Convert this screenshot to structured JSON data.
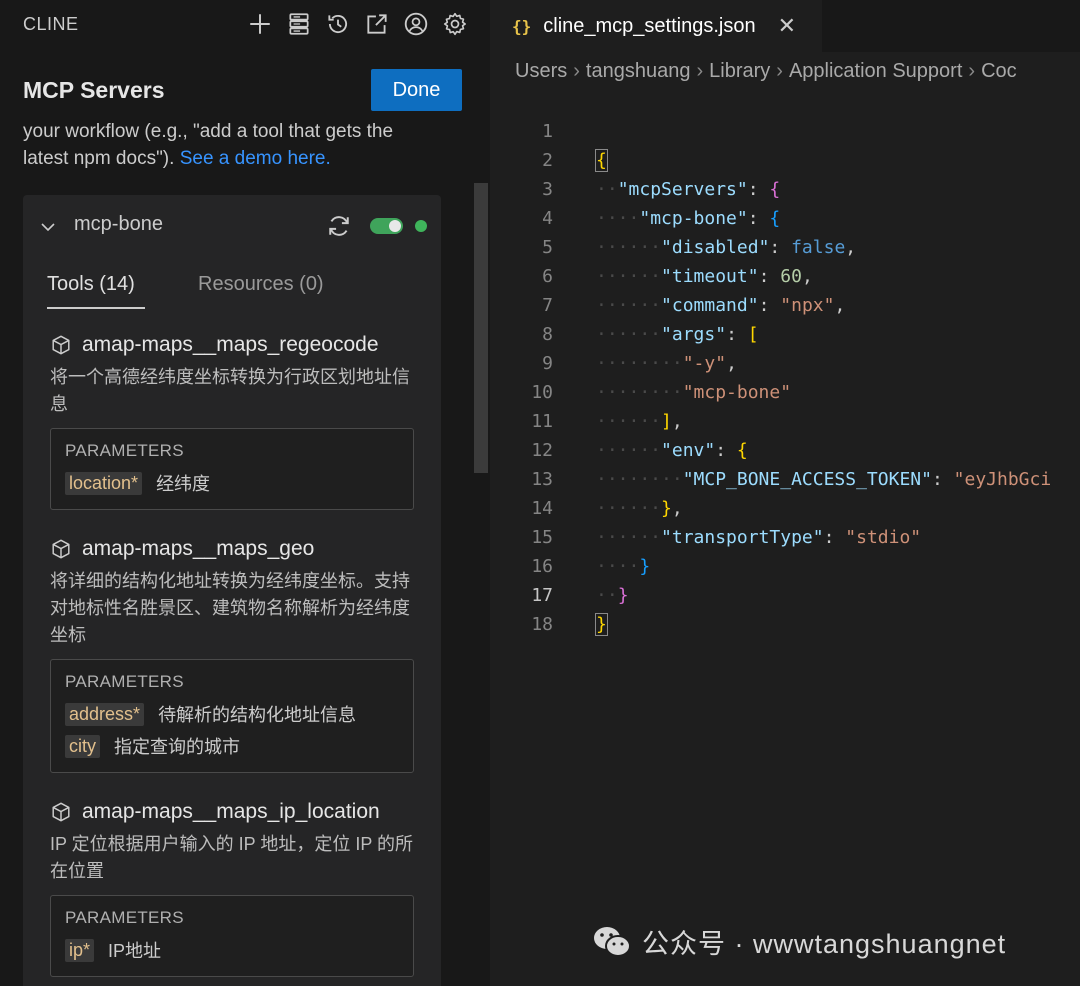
{
  "sidebar": {
    "brand": "CLINE",
    "header_icons": [
      "plus-icon",
      "server-stack-icon",
      "history-icon",
      "external-link-icon",
      "account-icon",
      "gear-icon"
    ],
    "title": "MCP Servers",
    "done_label": "Done",
    "description_text": "your workflow (e.g., \"add a tool that gets the latest npm docs\"). ",
    "description_link": "See a demo here.",
    "server": {
      "name": "mcp-bone",
      "enabled": true,
      "status_color": "#3fb45b",
      "tabs": {
        "tools": "Tools (14)",
        "resources": "Resources (0)"
      },
      "params_label": "PARAMETERS",
      "tools": [
        {
          "name": "amap-maps__maps_regeocode",
          "description": "将一个高德经纬度坐标转换为行政区划地址信息",
          "params": [
            {
              "name": "location",
              "required": "*",
              "desc": "经纬度"
            }
          ]
        },
        {
          "name": "amap-maps__maps_geo",
          "description": "将详细的结构化地址转换为经纬度坐标。支持对地标性名胜景区、建筑物名称解析为经纬度坐标",
          "params": [
            {
              "name": "address",
              "required": "*",
              "desc": "待解析的结构化地址信息"
            },
            {
              "name": "city",
              "required": "",
              "desc": "指定查询的城市"
            }
          ]
        },
        {
          "name": "amap-maps__maps_ip_location",
          "description": "IP 定位根据用户输入的 IP 地址，定位 IP 的所在位置",
          "params": [
            {
              "name": "ip",
              "required": "*",
              "desc": "IP地址"
            }
          ]
        }
      ]
    }
  },
  "editor": {
    "tab_filename": "cline_mcp_settings.json",
    "tab_icon": "{}",
    "close_glyph": "✕",
    "breadcrumb": [
      "Users",
      "tangshuang",
      "Library",
      "Application Support",
      "Coc"
    ],
    "active_line": 17,
    "line_numbers": [
      "1",
      "2",
      "3",
      "4",
      "5",
      "6",
      "7",
      "8",
      "9",
      "10",
      "11",
      "12",
      "13",
      "14",
      "15",
      "16",
      "17",
      "18"
    ],
    "code": {
      "l1_open": "{",
      "mcpServers": "\"mcpServers\"",
      "mcpBone": "\"mcp-bone\"",
      "disabled_key": "\"disabled\"",
      "disabled_val": "false",
      "timeout_key": "\"timeout\"",
      "timeout_val": "60",
      "command_key": "\"command\"",
      "command_val": "\"npx\"",
      "args_key": "\"args\"",
      "arg1": "\"-y\"",
      "arg2": "\"mcp-bone\"",
      "env_key": "\"env\"",
      "token_key": "\"MCP_BONE_ACCESS_TOKEN\"",
      "token_val": "\"eyJhbGci",
      "transport_key": "\"transportType\"",
      "transport_val": "\"stdio\""
    }
  },
  "watermark": {
    "text": "公众号 · wwwtangshuangnet",
    "icon": "wechat-icon"
  }
}
